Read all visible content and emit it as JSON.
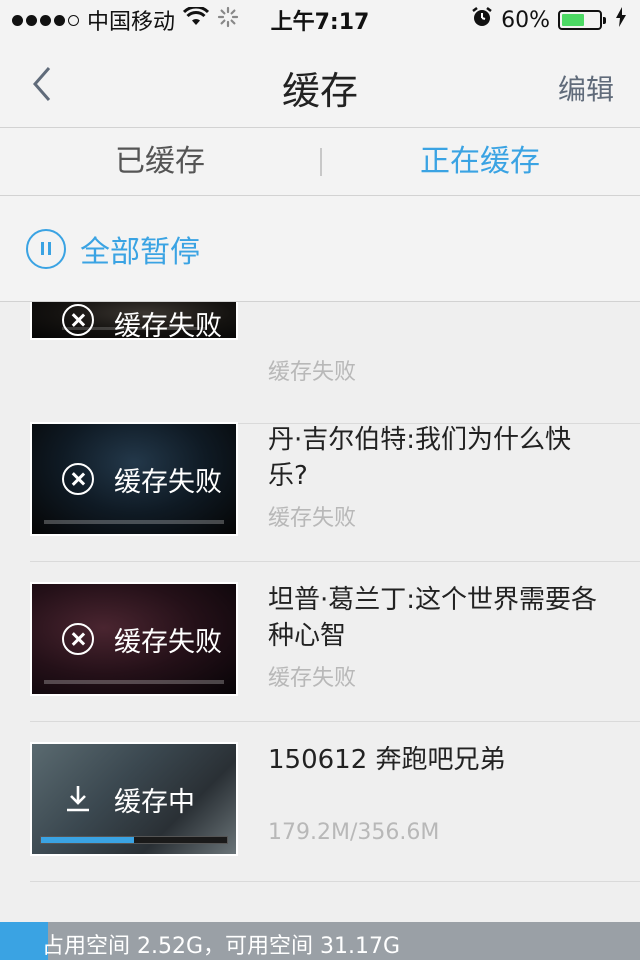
{
  "status_bar": {
    "carrier": "中国移动",
    "time": "上午7:17",
    "battery_percent_label": "60%",
    "battery_level": 0.6,
    "icons": [
      "signal-dots",
      "wifi-icon",
      "activity-spinner-icon",
      "alarm-icon",
      "battery-icon",
      "charging-icon"
    ]
  },
  "nav": {
    "title": "缓存",
    "edit_label": "编辑",
    "back_icon": "chevron-left-icon"
  },
  "tabs": [
    {
      "label": "已缓存",
      "active": false
    },
    {
      "label": "正在缓存",
      "active": true
    }
  ],
  "pause_all": {
    "label": "全部暂停",
    "icon": "pause-circle-icon"
  },
  "items": [
    {
      "title": "",
      "status": "缓存失败",
      "thumb_status": "缓存失败",
      "state": "failed"
    },
    {
      "title": "丹·吉尔伯特:我们为什么快乐?",
      "status": "缓存失败",
      "thumb_status": "缓存失败",
      "state": "failed"
    },
    {
      "title": "坦普·葛兰丁:这个世界需要各种心智",
      "status": "缓存失败",
      "thumb_status": "缓存失败",
      "state": "failed"
    },
    {
      "title": "150612 奔跑吧兄弟",
      "status": "179.2M/356.6M",
      "thumb_status": "缓存中",
      "state": "downloading",
      "progress": 0.5
    }
  ],
  "footer": {
    "storage_text": "占用空间 2.52G，可用空间 31.17G",
    "used_fraction": 0.075
  },
  "colors": {
    "accent": "#3aa3e3",
    "background": "#efefef",
    "muted_text": "#b8b8b8"
  }
}
